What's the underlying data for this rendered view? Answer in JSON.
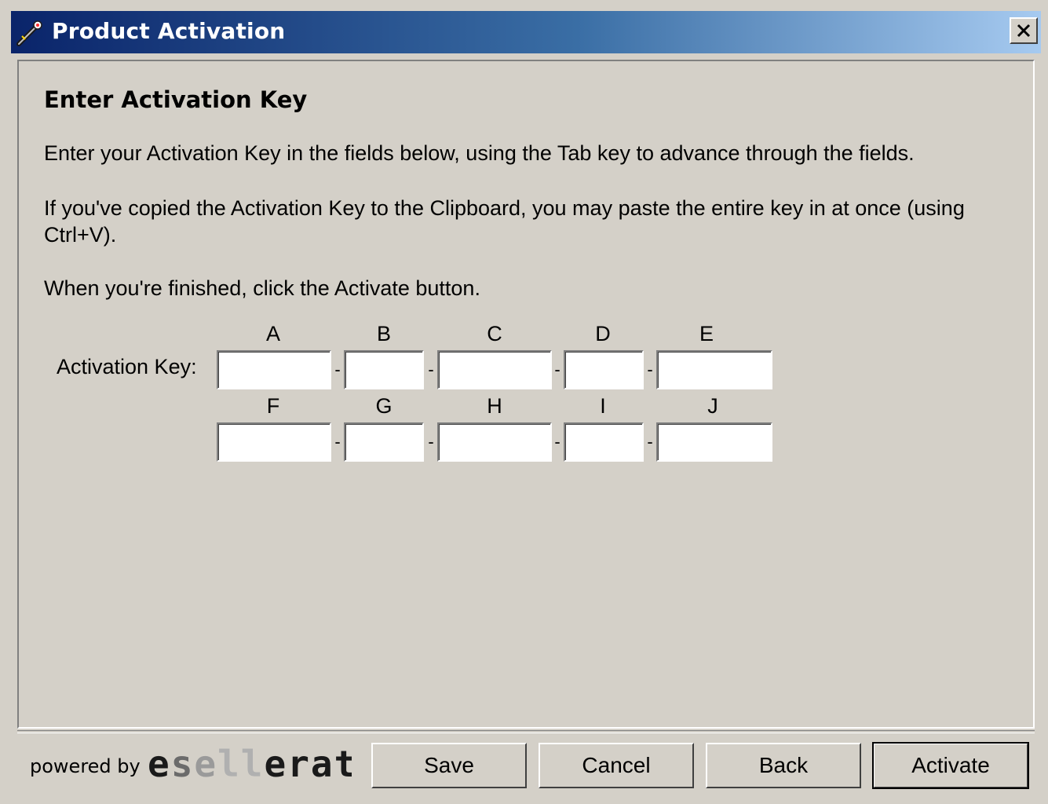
{
  "window": {
    "title": "Product Activation",
    "close_glyph": "✕"
  },
  "content": {
    "heading": "Enter Activation Key",
    "paragraph1": "Enter your Activation Key in the fields below, using the Tab key to advance through the fields.",
    "paragraph2": "If you've copied the Activation Key to the Clipboard, you may paste the entire key in at once (using Ctrl+V).",
    "paragraph3": "When you're finished, click the Activate button."
  },
  "key_form": {
    "label": "Activation Key:",
    "separator": "-",
    "row1_letters": [
      "A",
      "B",
      "C",
      "D",
      "E"
    ],
    "row2_letters": [
      "F",
      "G",
      "H",
      "I",
      "J"
    ],
    "row1_values": [
      "",
      "",
      "",
      "",
      ""
    ],
    "row2_values": [
      "",
      "",
      "",
      "",
      ""
    ]
  },
  "footer": {
    "powered_by": "powered by",
    "logo_text": "esellerate",
    "buttons": {
      "save": "Save",
      "cancel": "Cancel",
      "back": "Back",
      "activate": "Activate"
    }
  },
  "icons": {
    "title_icon": "key-wand-icon",
    "close_icon": "close-icon"
  },
  "colors": {
    "titlebar_start": "#0a246a",
    "titlebar_end": "#a6caf0",
    "face": "#d4d0c8"
  }
}
